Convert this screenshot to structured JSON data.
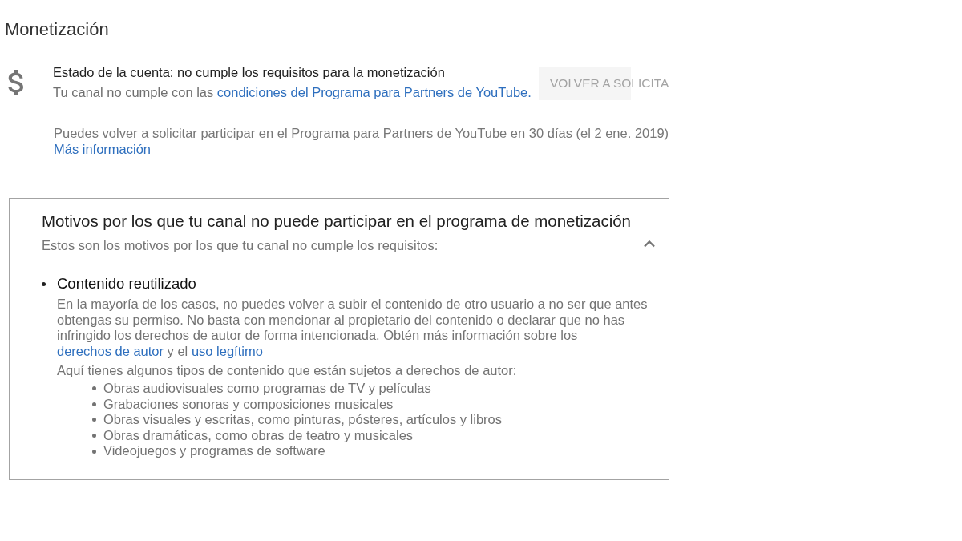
{
  "page_title": "Monetización",
  "account_status": {
    "title": "Estado de la cuenta: no cumple los requisitos para la monetización",
    "description": [
      {
        "kind": "text",
        "text": "Tu canal no cumple con las"
      },
      {
        "kind": "link",
        "text": "condiciones del Programa para Partners de YouTube."
      }
    ],
    "button": {
      "label": "VOLVER A SOLICITA",
      "disabled": true
    },
    "reapply_note": "Puedes volver a solicitar participar en el Programa para Partners de YouTube en 30 días (el 2 ene. 2019)",
    "more_info_link": "Más información"
  },
  "reasons_panel": {
    "title": "Motivos por los que tu canal no puede participar en el programa de monetización",
    "subtitle": "Estos son los motivos por los que tu canal no cumple los requisitos:",
    "expanded": true,
    "reasons": [
      {
        "title": "Contenido reutilizado",
        "description": [
          {
            "kind": "text",
            "text": "En la mayoría de los casos, no puedes volver a subir el contenido de otro usuario a no ser que antes obtengas su permiso. No basta con mencionar al propietario del contenido o declarar que no has infringido los derechos de autor de forma intencionada. Obtén más información sobre los"
          },
          {
            "kind": "link",
            "text": "derechos de autor"
          },
          {
            "kind": "text",
            "text": "y el"
          },
          {
            "kind": "link",
            "text": "uso legítimo"
          }
        ],
        "list_intro": "Aquí tienes algunos tipos de contenido que están sujetos a derechos de autor:",
        "list_items": [
          "Obras audiovisuales como programas de TV y películas",
          "Grabaciones sonoras y composiciones musicales",
          "Obras visuales y escritas, como pinturas, pósteres, artículos y libros",
          "Obras dramáticas, como obras de teatro y musicales",
          "Videojuegos y programas de software"
        ]
      }
    ]
  }
}
